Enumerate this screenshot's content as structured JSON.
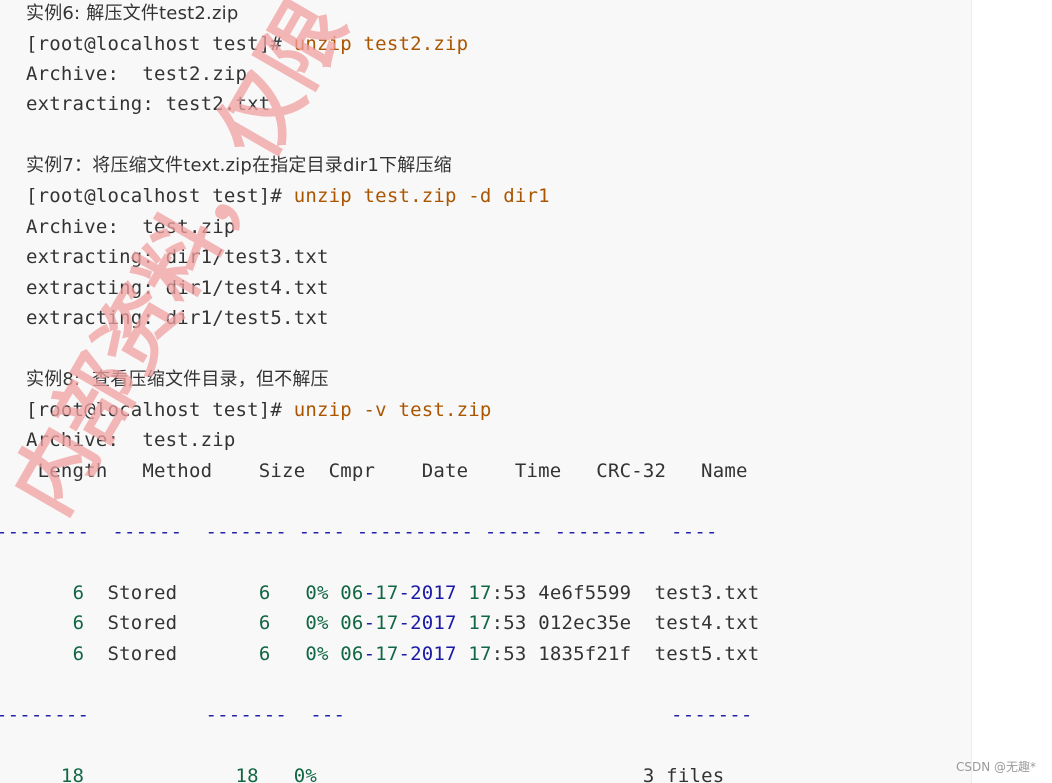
{
  "examples": [
    {
      "title": "实例6: 解压文件test2.zip",
      "prompt": "[root@localhost test]#",
      "command": " unzip test2.zip",
      "output": [
        "Archive:  test2.zip",
        "extracting: test2.txt"
      ]
    },
    {
      "title": "实例7：将压缩文件text.zip在指定目录dir1下解压缩",
      "prompt": "[root@localhost test]#",
      "command": " unzip test.zip -d dir1",
      "output": [
        "Archive:  test.zip",
        "extracting: dir1/test3.txt",
        "extracting: dir1/test4.txt",
        "extracting: dir1/test5.txt"
      ]
    },
    {
      "title": "实例8:  查看压缩文件目录，但不解压",
      "prompt": "[root@localhost test]#",
      "command": " unzip -v test.zip",
      "output": [
        "Archive:  test.zip"
      ]
    }
  ],
  "listing": {
    "header": " Length   Method    Size  Cmpr    Date    Time   CRC-32   Name",
    "separator": "--------  ------  ------- ---- ---------- ----- --------  ----",
    "rows": [
      {
        "length": "6",
        "method": "Stored",
        "size": "6",
        "cmpr": "0%",
        "date_m": "06",
        "date_d": "17",
        "date_y": "2017",
        "time_h": "17",
        "time_m": "53",
        "crc": "4e6f5599",
        "name": "test3.txt"
      },
      {
        "length": "6",
        "method": "Stored",
        "size": "6",
        "cmpr": "0%",
        "date_m": "06",
        "date_d": "17",
        "date_y": "2017",
        "time_h": "17",
        "time_m": "53",
        "crc": "012ec35e",
        "name": "test4.txt"
      },
      {
        "length": "6",
        "method": "Stored",
        "size": "6",
        "cmpr": "0%",
        "date_m": "06",
        "date_d": "17",
        "date_y": "2017",
        "time_h": "17",
        "time_m": "53",
        "crc": "1835f21f",
        "name": "test5.txt"
      }
    ],
    "footer_separator": "--------          -------  ---                            -------",
    "totals": {
      "length": "18",
      "size": "18",
      "cmpr": "0%",
      "files": "3 files"
    }
  },
  "watermark_text": "内部资料，仅限",
  "footer_label": "CSDN @无趣*",
  "colors": {
    "command": "#aa5500",
    "number": "#116644",
    "date_separator": "#1a1aa6",
    "separator": "#2222aa",
    "watermark": "#f2a0a0"
  }
}
